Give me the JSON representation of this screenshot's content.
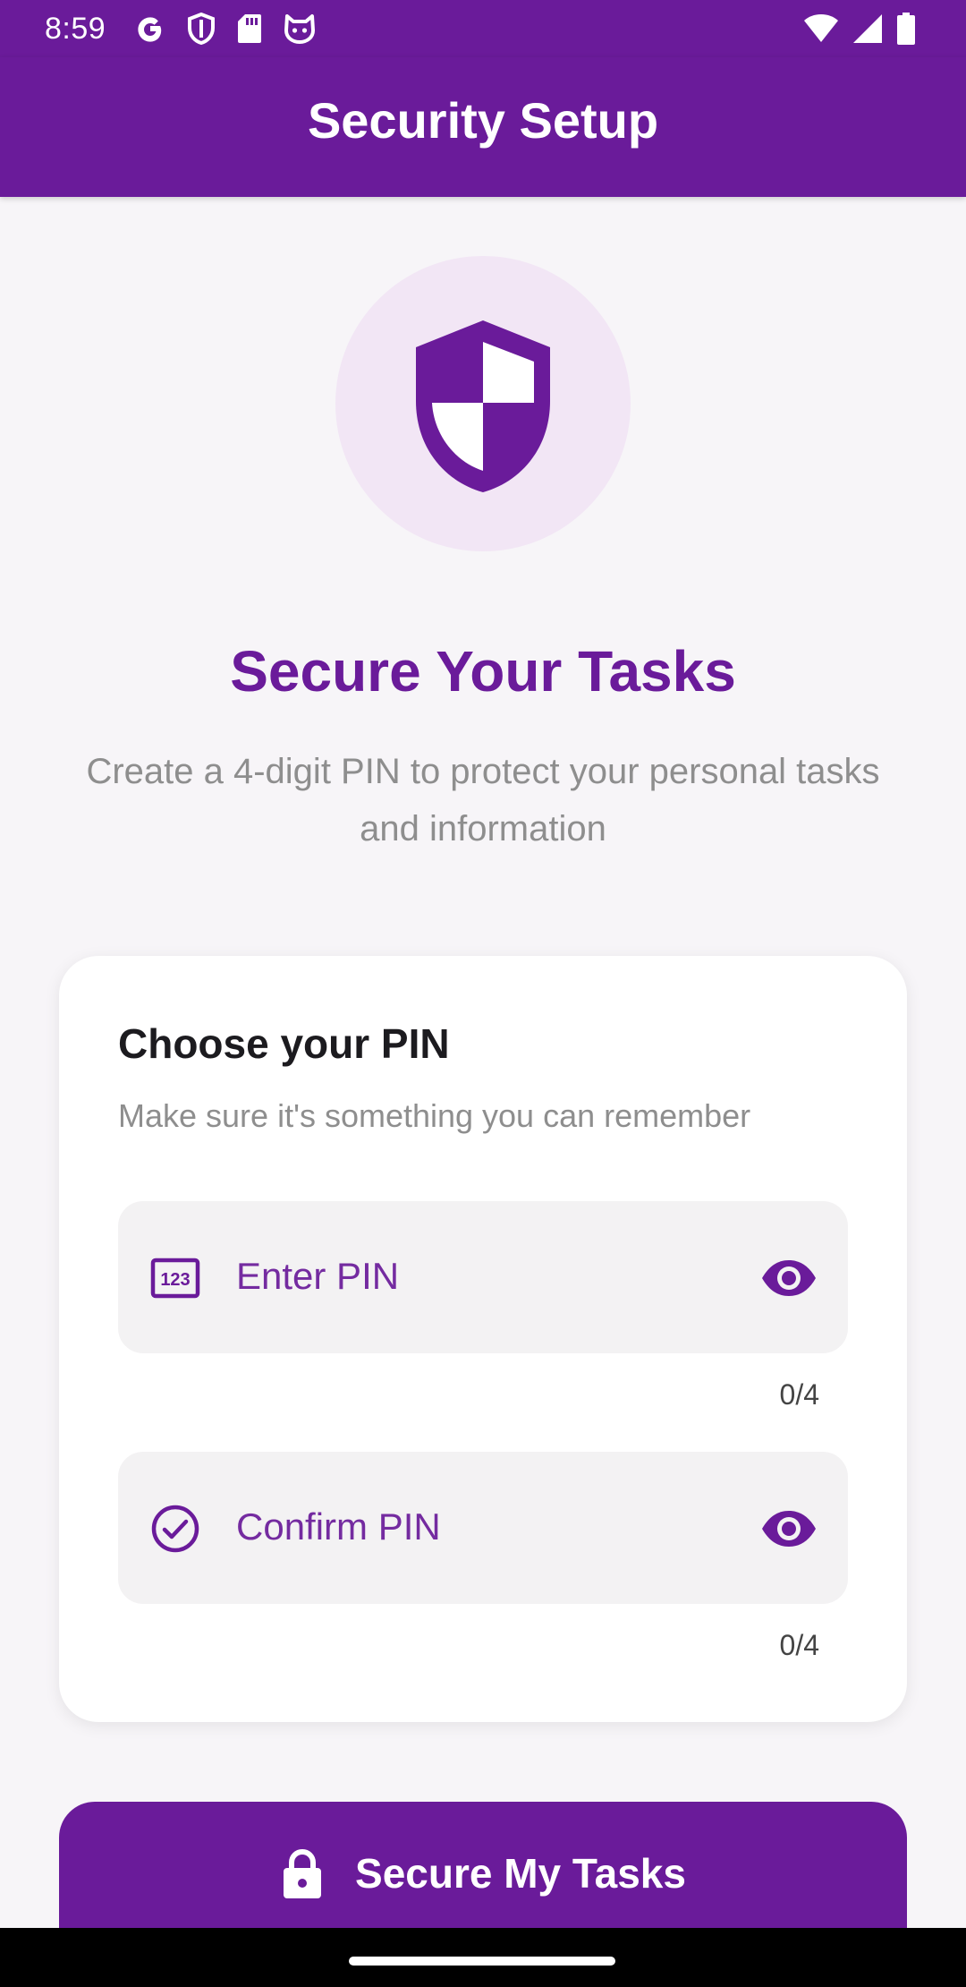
{
  "status_bar": {
    "time": "8:59",
    "left_icons": [
      "google-g-icon",
      "shield-notification-icon",
      "sd-card-icon",
      "cat-face-icon"
    ],
    "right_icons": [
      "wifi-icon",
      "cellular-signal-icon",
      "battery-icon"
    ]
  },
  "app_bar": {
    "title": "Security Setup"
  },
  "hero": {
    "icon": "shield-icon",
    "title": "Secure Your Tasks",
    "subtitle": "Create a 4-digit PIN to protect your personal tasks and information"
  },
  "pin_card": {
    "title": "Choose your PIN",
    "subtitle": "Make sure it's something you can remember",
    "fields": [
      {
        "leading_icon": "numeric-keypad-icon",
        "label": "Enter PIN",
        "value": "",
        "trailing_icon": "eye-icon",
        "counter": "0/4"
      },
      {
        "leading_icon": "check-circle-icon",
        "label": "Confirm PIN",
        "value": "",
        "trailing_icon": "eye-icon",
        "counter": "0/4"
      }
    ]
  },
  "primary_button": {
    "icon": "lock-icon",
    "label": "Secure My Tasks"
  },
  "colors": {
    "primary": "#6a1b9a",
    "primary_light": "#f2e6f5",
    "background": "#f7f5f8",
    "card": "#ffffff",
    "field": "#f3f2f3",
    "muted_text": "#8e8e8e"
  }
}
